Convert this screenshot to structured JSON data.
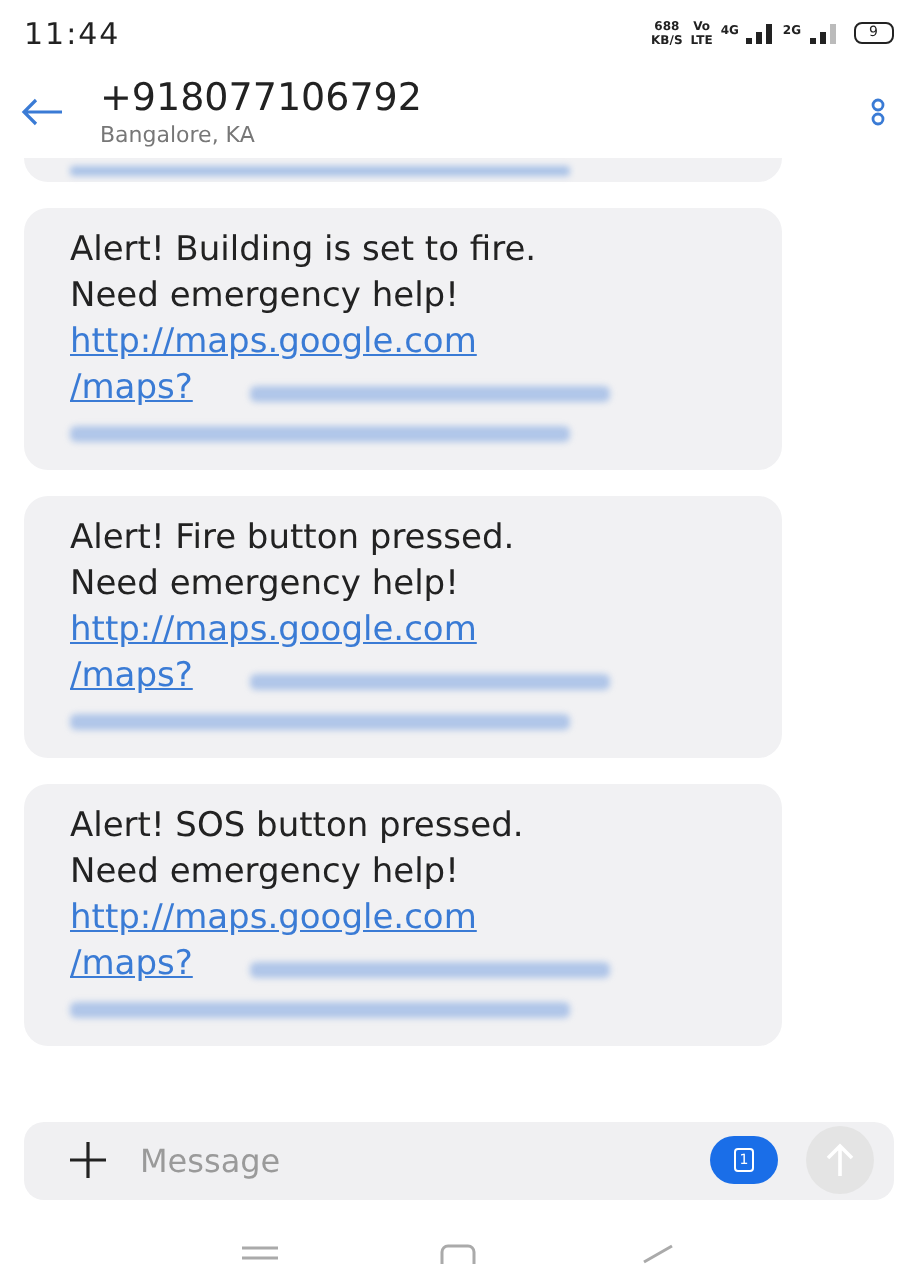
{
  "status_bar": {
    "time": "11:44",
    "speed": "688",
    "speed_unit": "KB/S",
    "volte_top": "Vo",
    "volte_bottom": "LTE",
    "sim1_network": "4G",
    "sim2_network": "2G",
    "battery": "9"
  },
  "header": {
    "title": "+918077106792",
    "subtitle": "Bangalore, KA"
  },
  "messages": [
    {
      "kind": "cut"
    },
    {
      "kind": "full",
      "text": "Alert! Building is set to fire.\nNeed emergency help!",
      "link": "http://maps.google.com\n/maps?"
    },
    {
      "kind": "full",
      "text": "Alert! Fire button pressed.\nNeed emergency help!",
      "link": "http://maps.google.com\n/maps?"
    },
    {
      "kind": "full",
      "text": "Alert! SOS button pressed.\nNeed emergency help!",
      "link": "http://maps.google.com\n/maps?"
    }
  ],
  "composer": {
    "placeholder": "Message",
    "sim": "1"
  }
}
